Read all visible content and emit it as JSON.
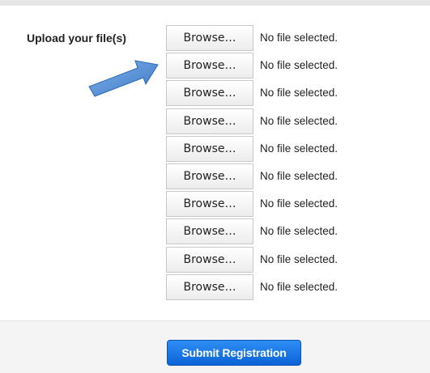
{
  "form": {
    "upload_label": "Upload your file(s)",
    "file_inputs": [
      {
        "button_label": "Browse…",
        "status": "No file selected."
      },
      {
        "button_label": "Browse…",
        "status": "No file selected."
      },
      {
        "button_label": "Browse…",
        "status": "No file selected."
      },
      {
        "button_label": "Browse…",
        "status": "No file selected."
      },
      {
        "button_label": "Browse…",
        "status": "No file selected."
      },
      {
        "button_label": "Browse…",
        "status": "No file selected."
      },
      {
        "button_label": "Browse…",
        "status": "No file selected."
      },
      {
        "button_label": "Browse…",
        "status": "No file selected."
      },
      {
        "button_label": "Browse…",
        "status": "No file selected."
      },
      {
        "button_label": "Browse…",
        "status": "No file selected."
      }
    ]
  },
  "annotation": {
    "icon": "pointer-arrow-icon",
    "color": "#4a86d0"
  },
  "footer": {
    "submit_label": "Submit Registration",
    "accent": "#0b63d6"
  }
}
